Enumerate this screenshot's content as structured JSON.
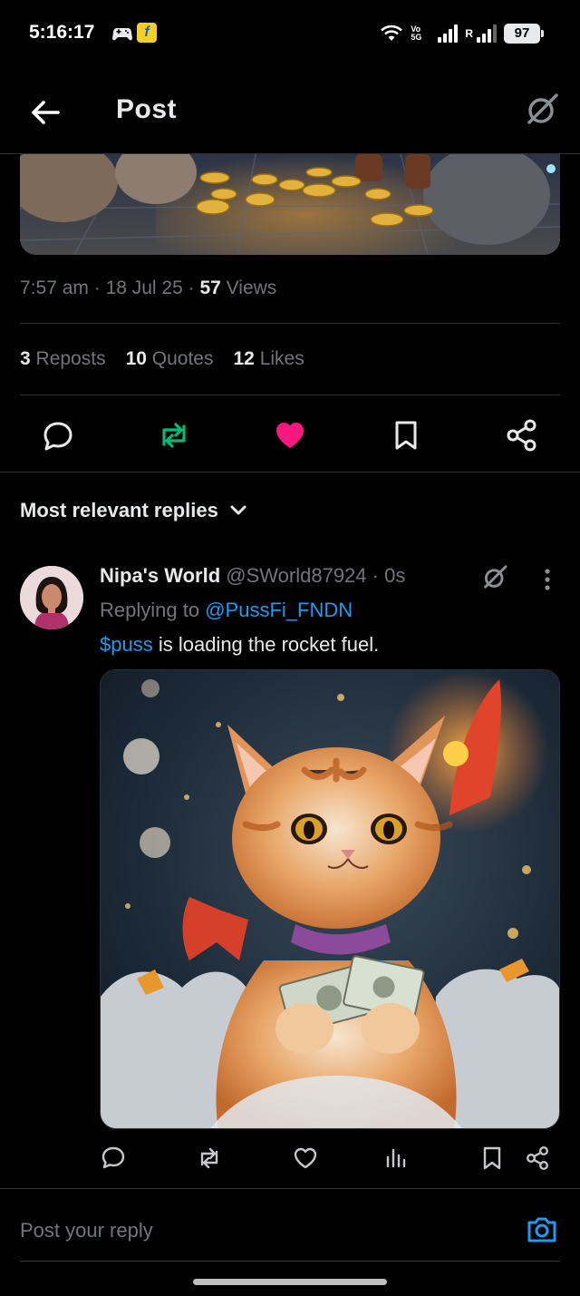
{
  "status_bar": {
    "time": "5:16:17",
    "volte": "Vo\n5G",
    "roaming": "R",
    "battery": "97",
    "icons": [
      "game-controller-icon",
      "flipkart-icon",
      "wifi-icon",
      "signal-icon",
      "signal-roaming-icon",
      "battery-icon"
    ]
  },
  "header": {
    "title": "Post",
    "back_icon": "arrow-left-icon",
    "grok_icon": "grok-icon"
  },
  "post": {
    "time": "7:57 am",
    "date": "18 Jul 25",
    "views_count": "57",
    "views_label": "Views",
    "reposts_count": "3",
    "reposts_label": "Reposts",
    "quotes_count": "10",
    "quotes_label": "Quotes",
    "likes_count": "12",
    "likes_label": "Likes",
    "liked": true,
    "reposted": true
  },
  "replies": {
    "sort_label": "Most relevant replies"
  },
  "reply": {
    "name": "Nipa's World",
    "handle": "@SWorld87924",
    "time": "0s",
    "replying_prefix": "Replying to",
    "replying_to": "@PussFi_FNDN",
    "cashtag": "$puss",
    "text": " is loading the rocket fuel."
  },
  "composer": {
    "placeholder": "Post your reply"
  },
  "colors": {
    "background": "#000000",
    "text": "#e7e9ea",
    "muted": "#71767b",
    "link": "#1d9bf0",
    "repost": "#00ba7c",
    "like": "#f91880",
    "divider": "#2f3336"
  }
}
